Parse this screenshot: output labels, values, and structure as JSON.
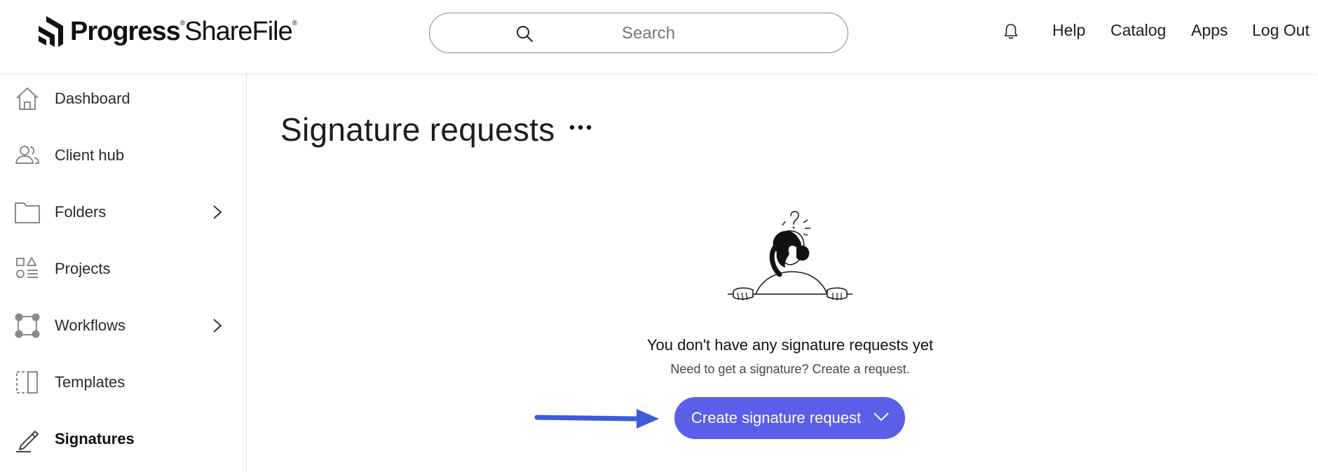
{
  "header": {
    "logo": {
      "word1": "Progress",
      "reg1": "®",
      "word2": "ShareFile",
      "reg2": "®"
    },
    "search": {
      "placeholder": "Search",
      "value": ""
    },
    "nav": {
      "help": "Help",
      "catalog": "Catalog",
      "apps": "Apps",
      "logout": "Log Out"
    }
  },
  "sidebar": {
    "items": [
      {
        "label": "Dashboard",
        "icon": "home-icon"
      },
      {
        "label": "Client hub",
        "icon": "users-icon"
      },
      {
        "label": "Folders",
        "icon": "folder-icon",
        "has_children": true
      },
      {
        "label": "Projects",
        "icon": "projects-icon"
      },
      {
        "label": "Workflows",
        "icon": "workflows-icon",
        "has_children": true
      },
      {
        "label": "Templates",
        "icon": "template-icon"
      },
      {
        "label": "Signatures",
        "icon": "pen-icon",
        "active": true
      }
    ]
  },
  "main": {
    "title": "Signature requests",
    "more_icon": "ellipsis-icon",
    "empty": {
      "title": "You don't have any signature requests yet",
      "subtitle": "Need to get a signature? Create a request."
    },
    "create_button": {
      "label": "Create signature request",
      "icon": "chevron-down-icon"
    }
  },
  "colors": {
    "accent": "#5b5ee8",
    "annotation_arrow": "#3b5bdb",
    "text": "#1d1d1f",
    "sidebar_icon": "#8a8a8a"
  }
}
